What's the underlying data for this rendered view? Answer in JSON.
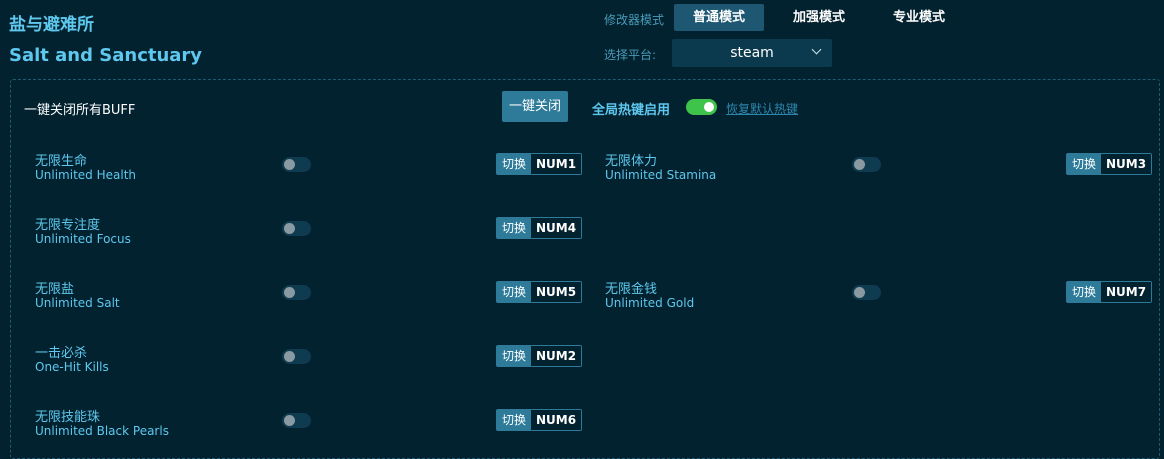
{
  "title": {
    "cn": "盐与避难所",
    "en": "Salt and Sanctuary"
  },
  "modes": {
    "label": "修改器模式",
    "options": [
      "普通模式",
      "加强模式",
      "专业模式"
    ],
    "active": "普通模式"
  },
  "platform": {
    "label": "选择平台:",
    "value": "steam"
  },
  "controls": {
    "buff_label": "一键关闭所有BUFF",
    "oneclick_button": "一键关闭",
    "hotkey_label": "全局热键启用",
    "hotkey_enabled": true,
    "reset_link": "恢复默认热键"
  },
  "cheats": [
    {
      "cn": "无限生命",
      "en": "Unlimited Health",
      "switch_label": "切换",
      "key": "NUM1",
      "enabled": false
    },
    {
      "cn": "无限体力",
      "en": "Unlimited Stamina",
      "switch_label": "切换",
      "key": "NUM3",
      "enabled": false
    },
    {
      "cn": "无限专注度",
      "en": "Unlimited Focus",
      "switch_label": "切换",
      "key": "NUM4",
      "enabled": false
    },
    {
      "cn": "无限盐",
      "en": "Unlimited Salt",
      "switch_label": "切换",
      "key": "NUM5",
      "enabled": false
    },
    {
      "cn": "无限金钱",
      "en": "Unlimited Gold",
      "switch_label": "切换",
      "key": "NUM7",
      "enabled": false
    },
    {
      "cn": "一击必杀",
      "en": "One-Hit Kills",
      "switch_label": "切换",
      "key": "NUM2",
      "enabled": false
    },
    {
      "cn": "无限技能珠",
      "en": "Unlimited Black Pearls",
      "switch_label": "切换",
      "key": "NUM6",
      "enabled": false
    }
  ],
  "colors": {
    "background": "#02222f",
    "accent": "#5ec8ee",
    "button": "#2d7a99",
    "toggle_on": "#3ec44b"
  }
}
